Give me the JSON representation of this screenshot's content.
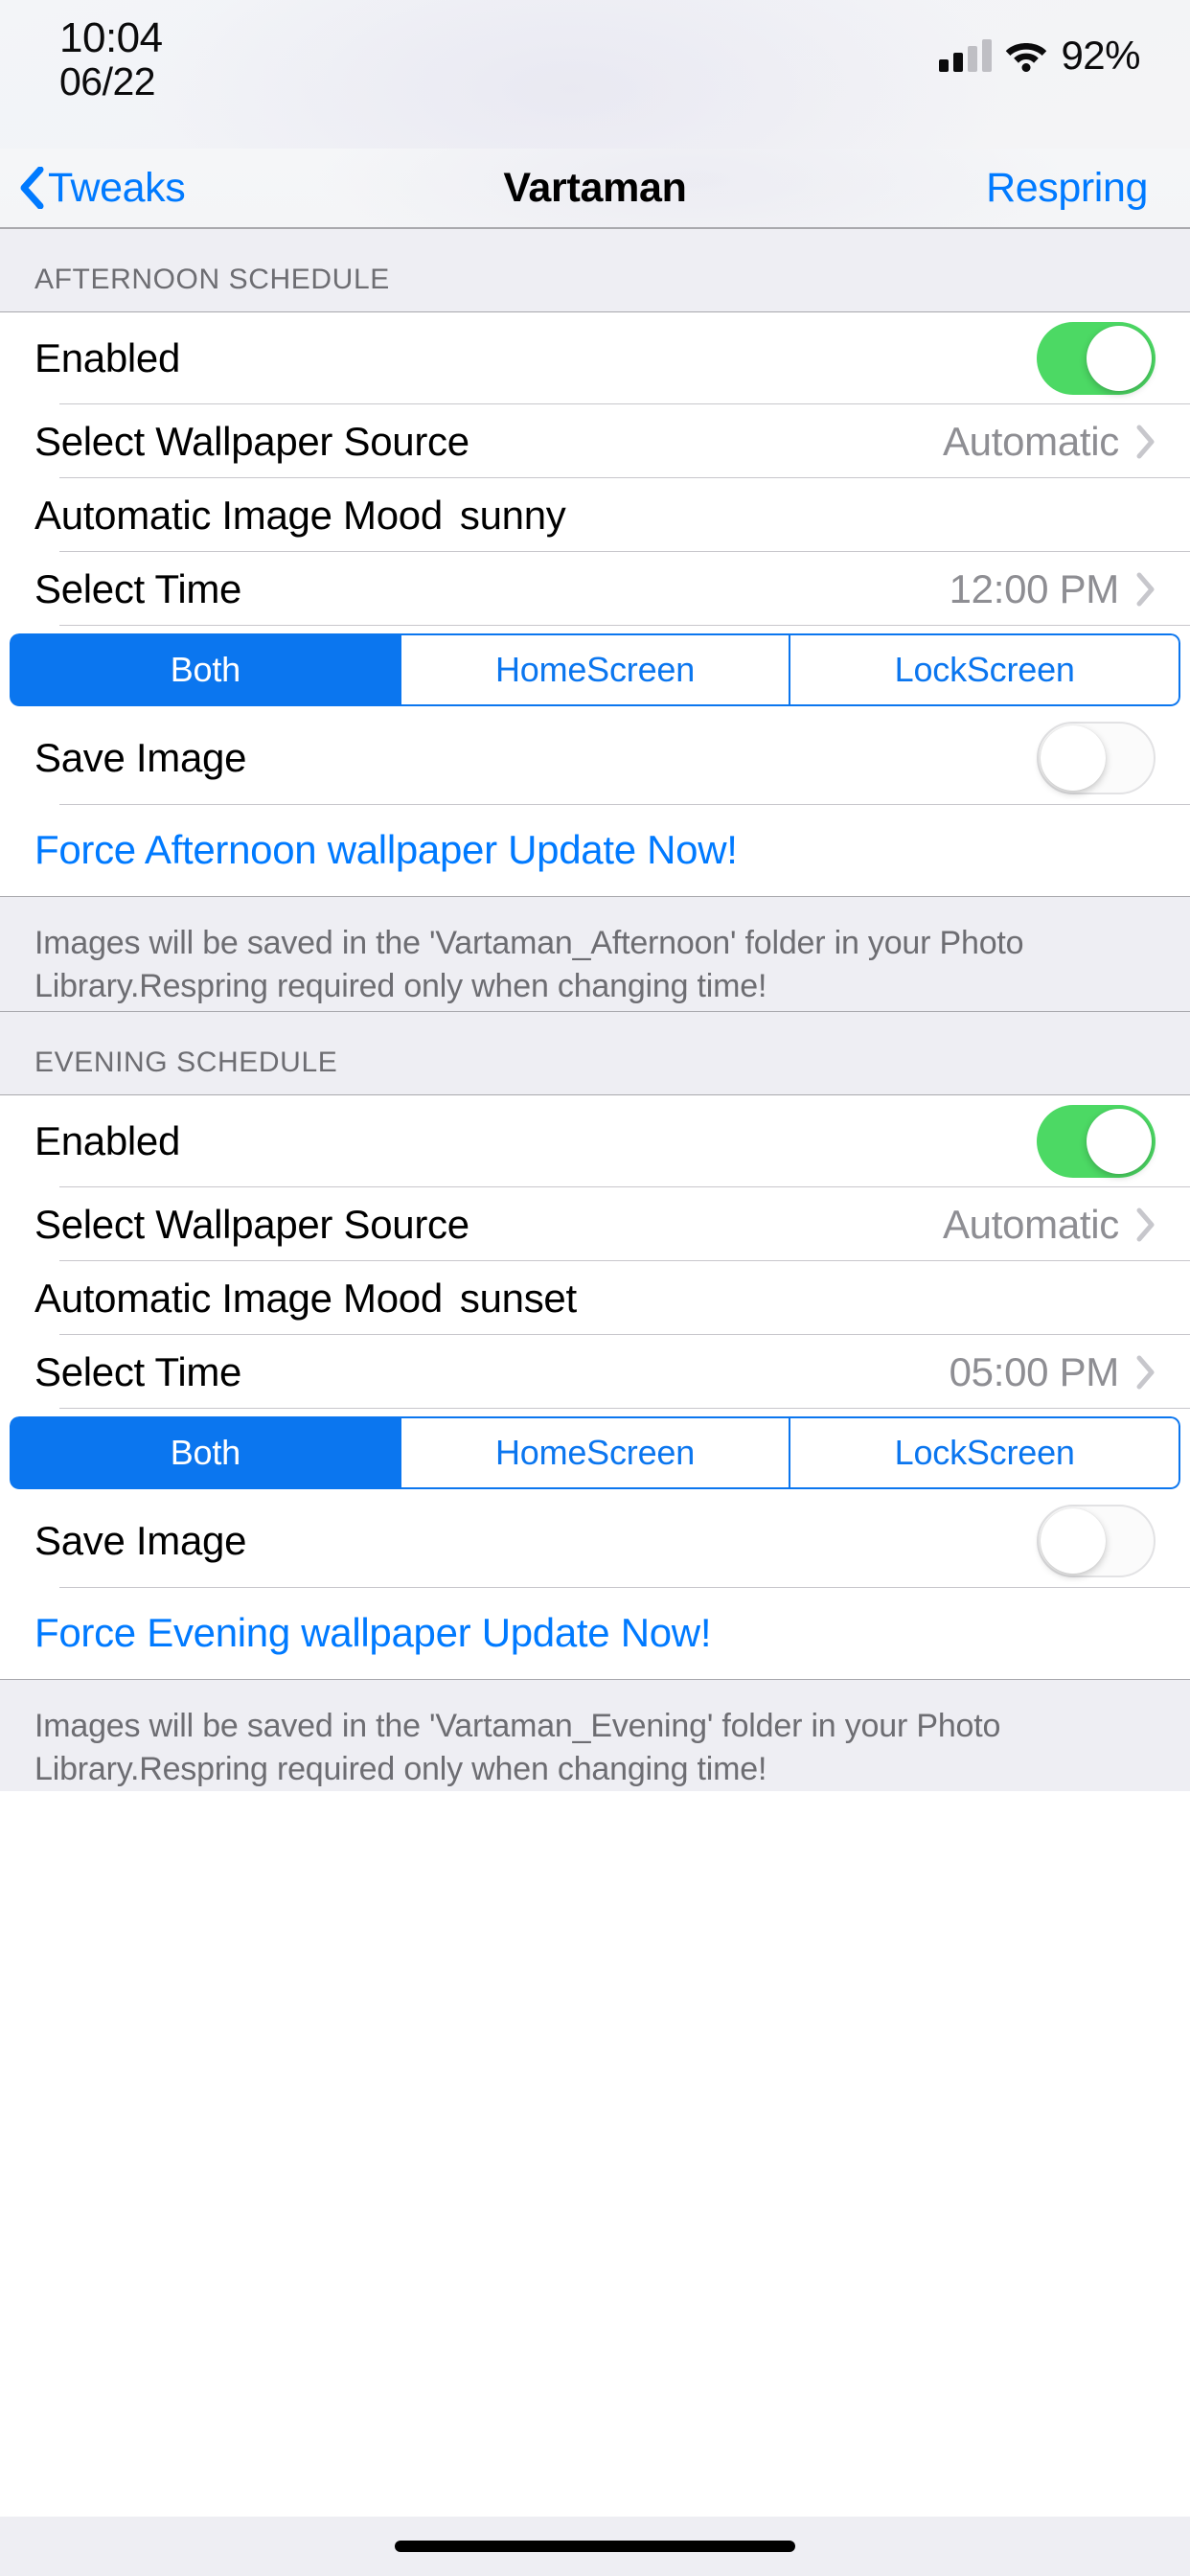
{
  "status_bar": {
    "time": "10:04",
    "date": "06/22",
    "battery_percent": "92%",
    "signal_icon": "cellular-signal-icon",
    "wifi_icon": "wifi-icon"
  },
  "nav_bar": {
    "back_label": "Tweaks",
    "back_icon": "chevron-left-icon",
    "title": "Vartaman",
    "action_label": "Respring"
  },
  "colors": {
    "accent_blue": "#007aff",
    "segment_blue": "#0b76ef",
    "toggle_on_green": "#4cd964",
    "value_gray": "#8e8e93",
    "header_gray": "#6d6d72",
    "group_bg": "#eeeef3"
  },
  "sections": [
    {
      "header": "AFTERNOON SCHEDULE",
      "rows": {
        "enabled_label": "Enabled",
        "enabled_state": "on",
        "source_label": "Select Wallpaper Source",
        "source_value": "Automatic",
        "mood_label": "Automatic Image Mood",
        "mood_value": "sunny",
        "time_label": "Select Time",
        "time_value": "12:00 PM",
        "save_image_label": "Save Image",
        "save_image_state": "off",
        "force_update_label": "Force Afternoon wallpaper Update Now!"
      },
      "segments": [
        {
          "label": "Both",
          "selected": true
        },
        {
          "label": "HomeScreen",
          "selected": false
        },
        {
          "label": "LockScreen",
          "selected": false
        }
      ],
      "footer": "Images will be saved in the 'Vartaman_Afternoon' folder in your Photo Library.Respring required only when changing time!"
    },
    {
      "header": "EVENING SCHEDULE",
      "rows": {
        "enabled_label": "Enabled",
        "enabled_state": "on",
        "source_label": "Select Wallpaper Source",
        "source_value": "Automatic",
        "mood_label": "Automatic Image Mood",
        "mood_value": "sunset",
        "time_label": "Select Time",
        "time_value": "05:00 PM",
        "save_image_label": "Save Image",
        "save_image_state": "off",
        "force_update_label": "Force Evening wallpaper Update Now!"
      },
      "segments": [
        {
          "label": "Both",
          "selected": true
        },
        {
          "label": "HomeScreen",
          "selected": false
        },
        {
          "label": "LockScreen",
          "selected": false
        }
      ],
      "footer": "Images will be saved in the 'Vartaman_Evening' folder in your Photo Library.Respring required only when changing time!"
    }
  ]
}
